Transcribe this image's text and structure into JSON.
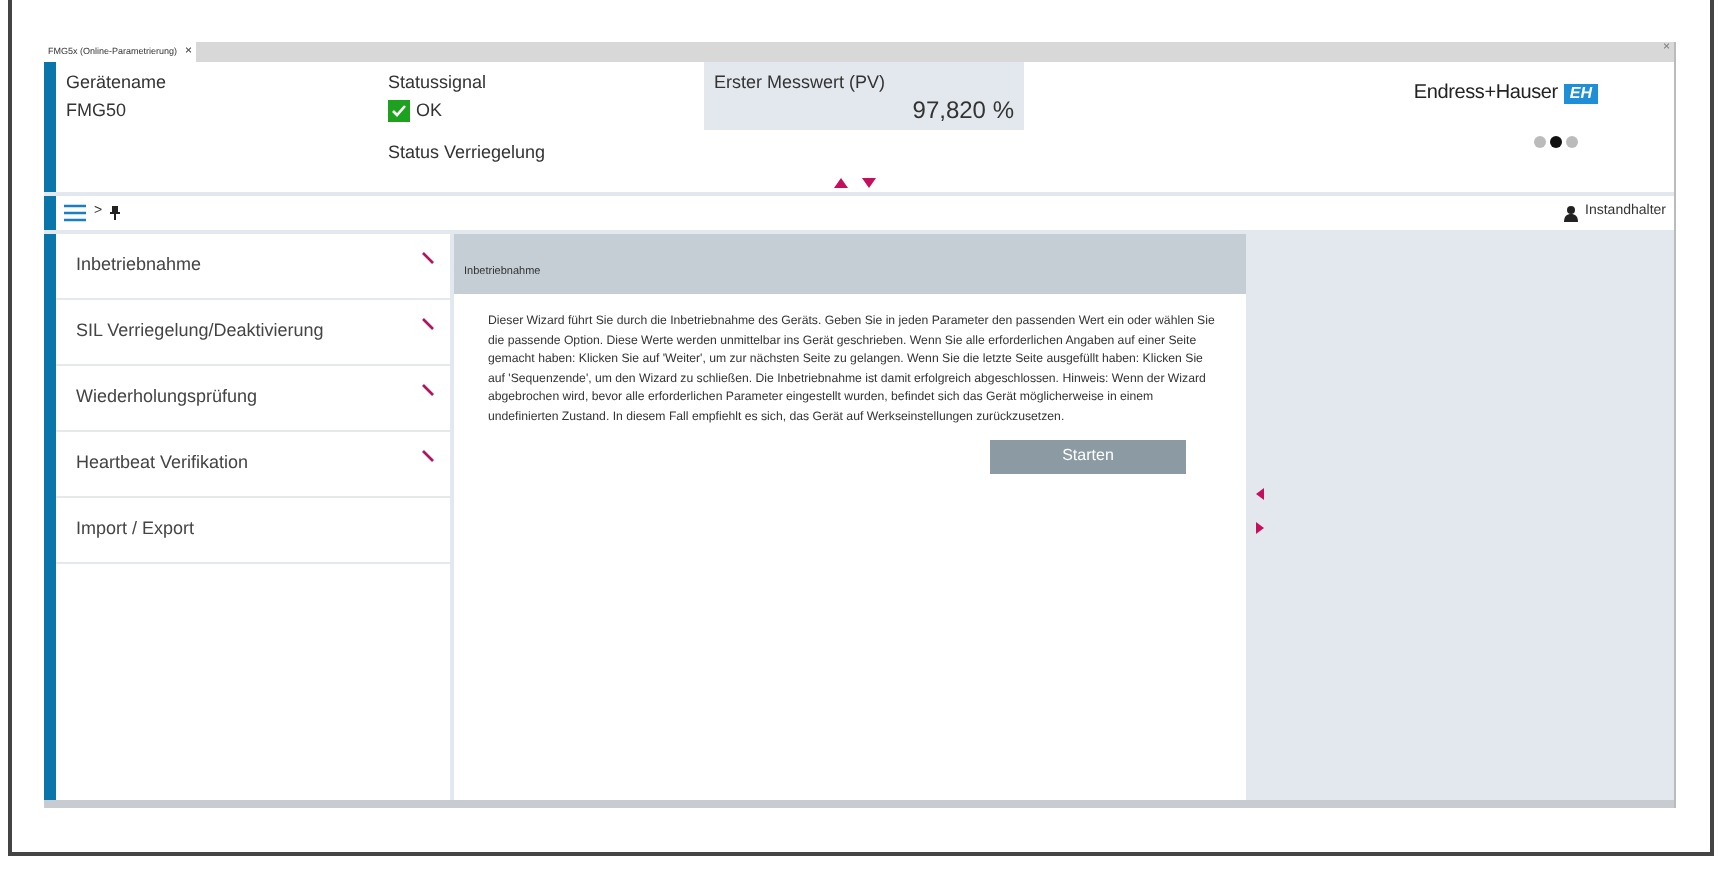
{
  "tab": {
    "title": "FMG5x (Online-Parametrierung)",
    "close": "×"
  },
  "window_close": "×",
  "header": {
    "device_name_label": "Gerätename",
    "device_name": "FMG50",
    "status_label": "Statussignal",
    "status": "OK",
    "lock_label": "Status Verriegelung",
    "pv_label": "Erster Messwert (PV)",
    "pv_value": "97,820 %",
    "brand": "Endress+Hauser",
    "brand_mark": "EH",
    "pages": [
      {
        "selected": false
      },
      {
        "selected": true
      },
      {
        "selected": false
      }
    ]
  },
  "toolbar": {
    "breadcrumb": ">",
    "user": "Instandhalter"
  },
  "sidebar": {
    "items": [
      {
        "label": "Inbetriebnahme",
        "wizard": true
      },
      {
        "label": "SIL Verriegelung/Deaktivierung",
        "wizard": true
      },
      {
        "label": "Wiederholungsprüfung",
        "wizard": true
      },
      {
        "label": "Heartbeat Verifikation",
        "wizard": true
      },
      {
        "label": "Import / Export",
        "wizard": false
      }
    ]
  },
  "content": {
    "title": "Inbetriebnahme",
    "text": "Dieser Wizard führt Sie durch die Inbetriebnahme des Geräts.  Geben Sie in jeden Parameter den passenden Wert ein oder wählen Sie die passende Option. Diese Werte werden unmittelbar ins Gerät geschrieben.  Wenn Sie alle erforderlichen Angaben auf einer Seite gemacht haben: Klicken Sie auf 'Weiter', um zur nächsten Seite zu gelangen. Wenn Sie die letzte Seite ausgefüllt haben: Klicken Sie auf 'Sequenzende', um den Wizard zu schließen. Die Inbetriebnahme ist damit erfolgreich abgeschlossen.  Hinweis: Wenn der Wizard abgebrochen wird, bevor alle erforderlichen Parameter eingestellt wurden, befindet sich das Gerät möglicherweise in einem undefinierten Zustand. In diesem Fall empfiehlt es sich, das Gerät auf Werkseinstellungen zurückzusetzen.",
    "button": "Starten"
  }
}
